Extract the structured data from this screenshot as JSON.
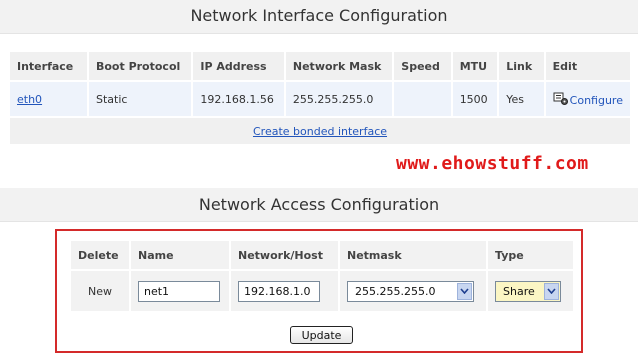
{
  "interfaces_section": {
    "title": "Network Interface Configuration",
    "columns": [
      "Interface",
      "Boot Protocol",
      "IP Address",
      "Network Mask",
      "Speed",
      "MTU",
      "Link",
      "Edit"
    ],
    "rows": [
      {
        "interface": "eth0",
        "boot_protocol": "Static",
        "ip_address": "192.168.1.56",
        "network_mask": "255.255.255.0",
        "speed": "",
        "mtu": "1500",
        "link": "Yes",
        "edit_label": "Configure",
        "edit_icon": "configure-icon"
      }
    ],
    "create_bonded_label": "Create bonded interface"
  },
  "watermark": "www.ehowstuff.com",
  "access_section": {
    "title": "Network Access Configuration",
    "columns": [
      "Delete",
      "Name",
      "Network/Host",
      "Netmask",
      "Type"
    ],
    "row": {
      "delete": "New",
      "name": "net1",
      "network_host": "192.168.1.0",
      "netmask": "255.255.255.0",
      "type": "Share"
    },
    "update_label": "Update"
  },
  "colors": {
    "highlight_border": "#d42a2a",
    "watermark": "#e01a1a",
    "link": "#2255bb",
    "row_bg": "#eef3fb",
    "header_bg": "#f0f0f0",
    "select_highlight": "#fbf6c4"
  }
}
